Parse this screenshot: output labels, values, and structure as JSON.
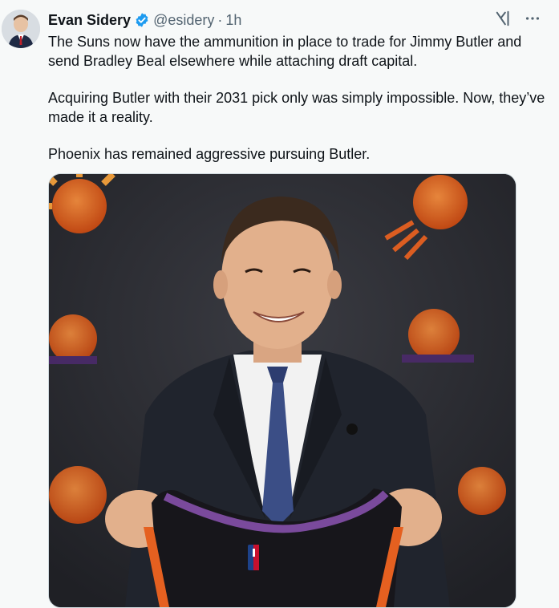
{
  "tweet": {
    "author": {
      "name": "Evan Sidery",
      "handle": "@esidery",
      "separator": "·",
      "time": "1h"
    },
    "paragraphs": [
      "The Suns now have the ammunition in place to trade for Jimmy Butler and send Bradley Beal elsewhere while attaching draft capital.",
      "Acquiring Butler with their 2031 pick only was simply impossible. Now, they’ve made it a reality.",
      "Phoenix has remained aggressive pursuing Butler."
    ]
  },
  "icons": {
    "verified": "verified-badge-icon",
    "grok": "grok-icon",
    "more": "more-options-icon"
  },
  "colors": {
    "background": "#f7f9f9",
    "text": "#0f1419",
    "secondary_text": "#536471",
    "verified_blue": "#1d9bf0",
    "suns_orange": "#e56020",
    "suns_purple": "#4b2a6b"
  }
}
